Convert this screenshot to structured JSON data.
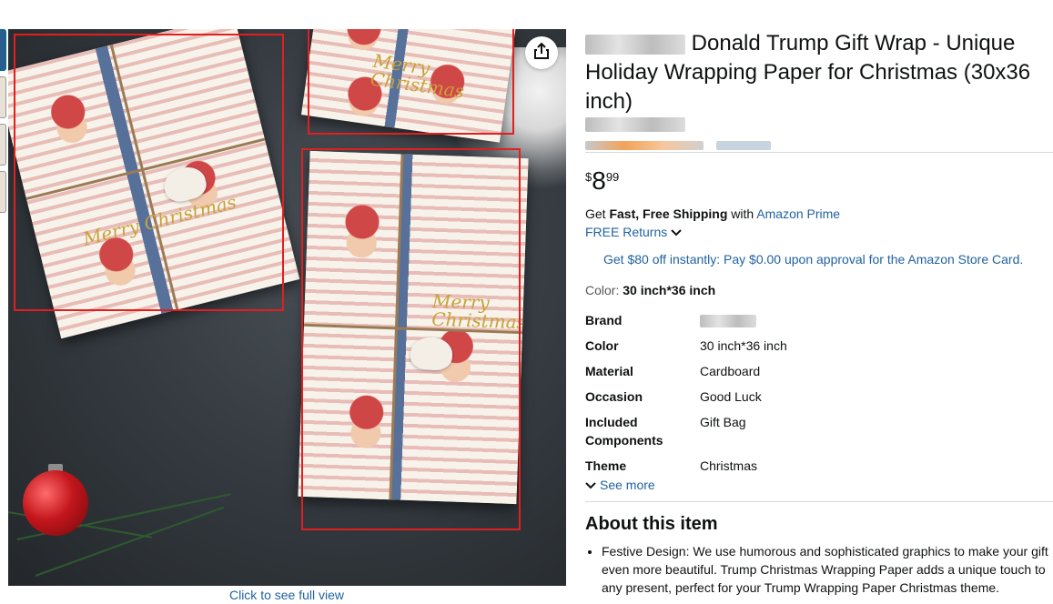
{
  "product": {
    "title": "Donald Trump Gift Wrap - Unique Holiday Wrapping Paper for Christmas (30x36 inch)",
    "price_symbol": "$",
    "price_whole": "8",
    "price_fraction": "99",
    "image_link": "Click to see full view"
  },
  "image": {
    "overlay_text_1": "Merry Christmas",
    "overlay_text_2": "Merry Christmas",
    "overlay_text_3": "Merry Christmas"
  },
  "shipping": {
    "get": "Get ",
    "fast_free": "Fast, Free Shipping",
    "with": " with ",
    "prime": "Amazon Prime",
    "returns": "FREE Returns"
  },
  "offer": "Get $80 off instantly: Pay $0.00 upon approval for the Amazon Store Card.",
  "color": {
    "label": "Color: ",
    "value": "30 inch*36 inch"
  },
  "specs": [
    {
      "key": "Brand",
      "value": ""
    },
    {
      "key": "Color",
      "value": "30 inch*36 inch"
    },
    {
      "key": "Material",
      "value": "Cardboard"
    },
    {
      "key": "Occasion",
      "value": "Good Luck"
    },
    {
      "key": "Included Components",
      "value": "Gift Bag"
    },
    {
      "key": "Theme",
      "value": "Christmas"
    }
  ],
  "see_more": "See more",
  "about": {
    "heading": "About this item",
    "bullets": [
      "Festive Design: We use humorous and sophisticated graphics to make your gift even more beautiful. Trump Christmas Wrapping Paper adds a unique touch to any present, perfect for your Trump Wrapping Paper Christmas theme."
    ]
  },
  "colors": {
    "link": "#2162a1",
    "text": "#0f1111",
    "annotation_box": "#e02020"
  },
  "icons": {
    "share": "share-icon",
    "chevron": "chevron-down-icon"
  }
}
